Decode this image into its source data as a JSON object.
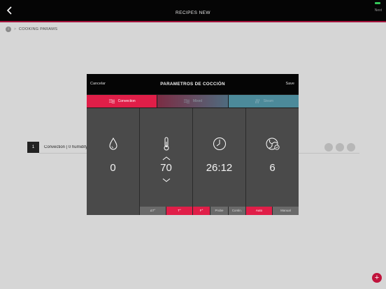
{
  "topbar": {
    "title": "RECIPES NEW",
    "next_label": "Next"
  },
  "breadcrumb": {
    "home_glyph": "i",
    "separator": ">",
    "current": "COOKING PARAMS"
  },
  "list": {
    "step_number": "1",
    "step_text": "Convection | 0 humidity"
  },
  "modal": {
    "cancel_label": "Cancelar",
    "title": "PARAMETROS DE COCCIÓN",
    "save_label": "Save",
    "modes": [
      {
        "label": "Convection",
        "active": true
      },
      {
        "label": "Mixed",
        "active": false
      },
      {
        "label": "Steam",
        "active": false
      }
    ],
    "humidity": {
      "value": "0",
      "icon": "water-drop-icon"
    },
    "temperature": {
      "value": "70",
      "icon": "thermometer-icon",
      "options": [
        "ΔT°",
        "T°",
        "F°"
      ],
      "selected": "T°"
    },
    "time": {
      "value": "26:12",
      "icon": "clock-icon",
      "options": [
        "Probe",
        "Contin."
      ]
    },
    "fan": {
      "value": "6",
      "icon": "fan-speed-icon",
      "options": [
        "Auto",
        "Manual"
      ],
      "selected": "Auto"
    }
  },
  "colors": {
    "accent": "#e01e48",
    "topbar": "#050505",
    "background": "#d6d6d6",
    "panel": "#4a4a4a"
  }
}
